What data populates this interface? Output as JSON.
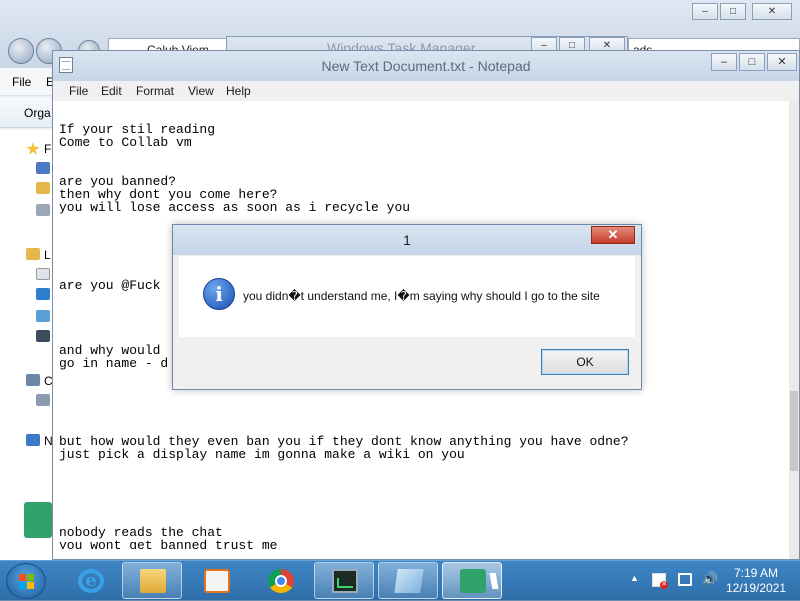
{
  "explorer": {
    "address_text": "Calub Viem",
    "search_text": "ads",
    "menu": [
      "File",
      "E"
    ],
    "toolbar_label": "Orga",
    "sidebar_letters": [
      "F",
      "L",
      "C",
      "N"
    ]
  },
  "task_manager": {
    "title": "Windows Task Manager"
  },
  "notepad": {
    "title": "New Text Document.txt - Notepad",
    "menu": [
      "File",
      "Edit",
      "Format",
      "View",
      "Help"
    ],
    "text": "If your stil reading\nCome to Collab vm\n\n\nare you banned?\nthen why dont you come here?\nyou will lose access as soon as i recycle you\n\n\n\n\n\nare you @Fuck \n\n\n\n\nand why would\ngo in name - d\n\n\n\n\n\nbut how would they even ban you if they dont know anything you have odne?\njust pick a display name im gonna make a wiki on you\n\n\n\n\n\nnobody reads the chat\nyou wont get banned trust me\neven if you are",
    "window_buttons": [
      "–",
      "□",
      "✕"
    ]
  },
  "dialog": {
    "title": "1",
    "message": "you didn�t understand me, I�m saying why should I go to the site",
    "ok_label": "OK",
    "close_label": "✕",
    "icon": "info-icon"
  },
  "taskbar": {
    "items": [
      {
        "name": "internet-explorer",
        "state": "pinned"
      },
      {
        "name": "file-explorer",
        "state": "open"
      },
      {
        "name": "media-player",
        "state": "pinned"
      },
      {
        "name": "chrome",
        "state": "pinned"
      },
      {
        "name": "task-manager",
        "state": "open"
      },
      {
        "name": "notepad",
        "state": "open"
      },
      {
        "name": "collab-app",
        "state": "active"
      }
    ],
    "tray_arrow": "▲",
    "volume_glyph": "🔊",
    "time": "7:19 AM",
    "date": "12/19/2021"
  },
  "colors": {
    "taskbar": "#2e6ea8",
    "dialog_close": "#c43c2a",
    "info_icon": "#1c4fb2"
  }
}
